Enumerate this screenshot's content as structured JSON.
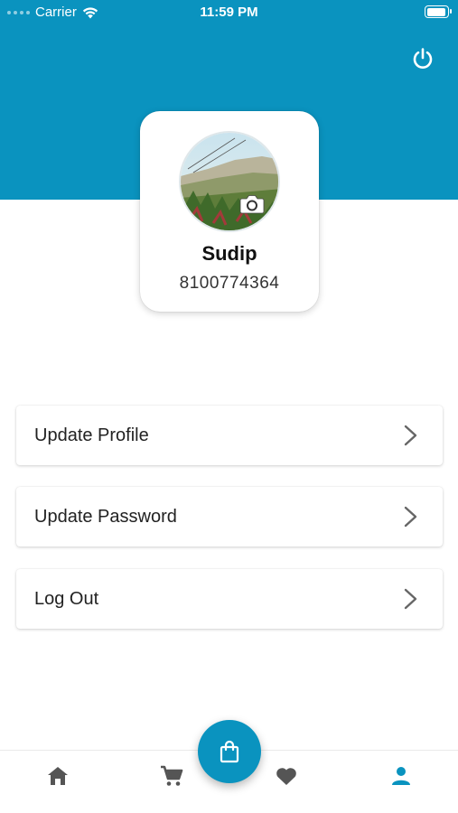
{
  "status_bar": {
    "carrier": "Carrier",
    "time": "11:59 PM",
    "battery_level": 1.0
  },
  "header": {
    "background_color": "#0a93bf",
    "power_icon": "power-icon"
  },
  "profile": {
    "name": "Sudip",
    "phone": "8100774364",
    "avatar_icon": "avatar-photo",
    "camera_icon": "camera-icon"
  },
  "menu": {
    "items": [
      {
        "label": "Update Profile",
        "icon": "chevron-right-icon"
      },
      {
        "label": "Update Password",
        "icon": "chevron-right-icon"
      },
      {
        "label": "Log Out",
        "icon": "chevron-right-icon"
      }
    ]
  },
  "bottom_nav": {
    "items": [
      {
        "icon": "home-icon",
        "active": false
      },
      {
        "icon": "cart-icon",
        "active": false
      },
      {
        "icon": "shopping-bag-icon",
        "active": false
      },
      {
        "icon": "heart-icon",
        "active": false
      },
      {
        "icon": "person-icon",
        "active": true
      }
    ],
    "active_color": "#0a93bf",
    "inactive_color": "#555555"
  }
}
